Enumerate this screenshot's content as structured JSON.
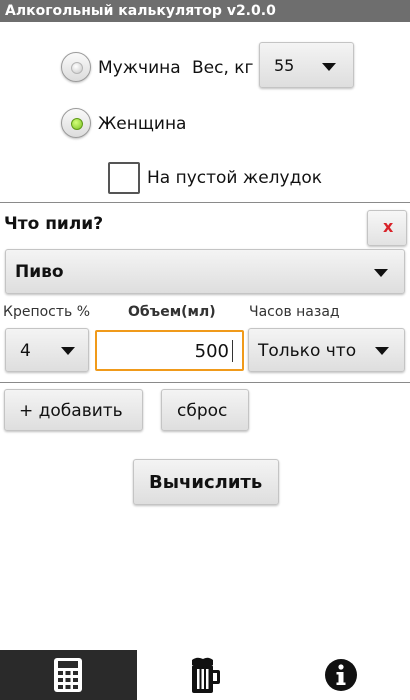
{
  "app": {
    "title": "Алкогольный калькулятор   v2.0.0"
  },
  "gender": {
    "male_label": "Мужчина",
    "female_label": "Женщина",
    "selected": "female"
  },
  "weight": {
    "label": "Вес, кг",
    "value": "55"
  },
  "empty_stomach": {
    "label": "На пустой желудок",
    "checked": false
  },
  "drinks": {
    "heading": "Что пили?",
    "remove_label": "x",
    "type_value": "Пиво",
    "strength_label": "Крепость %",
    "strength_value": "4",
    "volume_label": "Объем(мл)",
    "volume_value": "500",
    "hours_label": "Часов назад",
    "hours_value": "Только что"
  },
  "actions": {
    "add_label": "+ добавить",
    "reset_label": "сброс",
    "calculate_label": "Вычислить"
  },
  "bottom_nav": {
    "tabs": [
      "calculator-icon",
      "beer-mug-icon",
      "info-icon"
    ],
    "active": "calculator-icon"
  },
  "colors": {
    "titlebar_bg": "#6e6e6e",
    "accent_focus": "#f09a1a",
    "remove_x": "#d9232a",
    "radio_checked": "#7bc225",
    "tab_active_bg": "#2a2a2a"
  }
}
